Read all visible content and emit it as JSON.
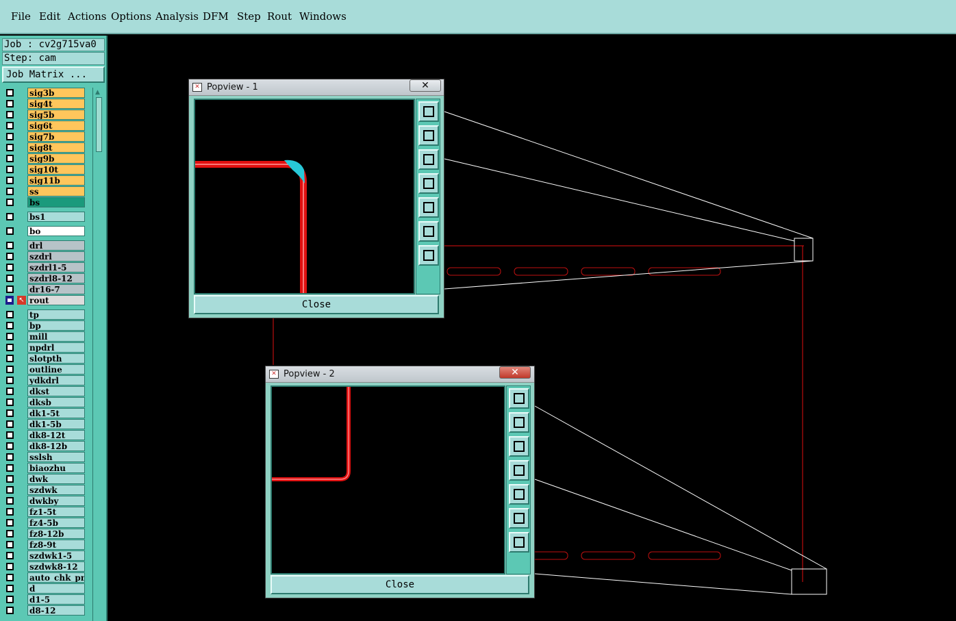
{
  "menu": [
    "File",
    "Edit",
    "Actions",
    "Options",
    "Analysis",
    "DFM",
    "Step",
    "Rout",
    "Windows"
  ],
  "job": {
    "job_line": "Job : cv2g715va0",
    "step_line": "Step: cam",
    "matrix_button": "Job Matrix ..."
  },
  "layers": [
    {
      "name": "sig3b",
      "color": "sig"
    },
    {
      "name": "sig4t",
      "color": "sig"
    },
    {
      "name": "sig5b",
      "color": "sig"
    },
    {
      "name": "sig6t",
      "color": "sig"
    },
    {
      "name": "sig7b",
      "color": "sig"
    },
    {
      "name": "sig8t",
      "color": "sig"
    },
    {
      "name": "sig9b",
      "color": "sig"
    },
    {
      "name": "sig10t",
      "color": "sig"
    },
    {
      "name": "sig11b",
      "color": "sig"
    },
    {
      "name": "ss",
      "color": "sig"
    },
    {
      "name": "bs",
      "color": "bs"
    },
    {
      "name": "bs1",
      "color": "teal"
    },
    {
      "name": "bo",
      "color": "white"
    },
    {
      "name": "drl",
      "color": "gray"
    },
    {
      "name": "szdrl",
      "color": "gray"
    },
    {
      "name": "szdrl1-5",
      "color": "gray"
    },
    {
      "name": "szdrl8-12",
      "color": "gray"
    },
    {
      "name": "dr16-7",
      "color": "gray"
    },
    {
      "name": "rout",
      "color": "rout"
    },
    {
      "name": "tp",
      "color": "teal"
    },
    {
      "name": "bp",
      "color": "teal"
    },
    {
      "name": "mill",
      "color": "teal"
    },
    {
      "name": "npdrl",
      "color": "teal"
    },
    {
      "name": "slotpth",
      "color": "teal"
    },
    {
      "name": "outline",
      "color": "teal"
    },
    {
      "name": "ydkdrl",
      "color": "teal"
    },
    {
      "name": "dkst",
      "color": "teal"
    },
    {
      "name": "dksb",
      "color": "teal"
    },
    {
      "name": "dk1-5t",
      "color": "teal"
    },
    {
      "name": "dk1-5b",
      "color": "teal"
    },
    {
      "name": "dk8-12t",
      "color": "teal"
    },
    {
      "name": "dk8-12b",
      "color": "teal"
    },
    {
      "name": "sslsh",
      "color": "teal"
    },
    {
      "name": "biaozhu",
      "color": "teal"
    },
    {
      "name": "dwk",
      "color": "teal"
    },
    {
      "name": "szdwk",
      "color": "teal"
    },
    {
      "name": "dwkby",
      "color": "teal"
    },
    {
      "name": "fz1-5t",
      "color": "teal"
    },
    {
      "name": "fz4-5b",
      "color": "teal"
    },
    {
      "name": "fz8-12b",
      "color": "teal"
    },
    {
      "name": "fz8-9t",
      "color": "teal"
    },
    {
      "name": "szdwk1-5",
      "color": "teal"
    },
    {
      "name": "szdwk8-12",
      "color": "teal"
    },
    {
      "name": "auto_chk_pnl",
      "color": "teal"
    },
    {
      "name": "d",
      "color": "teal"
    },
    {
      "name": "d1-5",
      "color": "teal"
    },
    {
      "name": "d8-12",
      "color": "teal"
    }
  ],
  "popview1": {
    "title": "Popview - 1",
    "close_label": "Close",
    "close_x": "✕"
  },
  "popview2": {
    "title": "Popview - 2",
    "close_label": "Close",
    "close_x": "✕"
  },
  "tool_icons": [
    "zoom-fit-icon",
    "pan-up-icon",
    "pan-down-icon",
    "pan-left-icon",
    "pan-right-icon",
    "zoom-in-icon",
    "zoom-out-icon"
  ],
  "colors": {
    "accent": "#5cc8b4",
    "menubar": "#a8dcd9",
    "trace": "#e01010",
    "highlight": "#28c8d8",
    "signal_layer": "#ffc65c"
  }
}
